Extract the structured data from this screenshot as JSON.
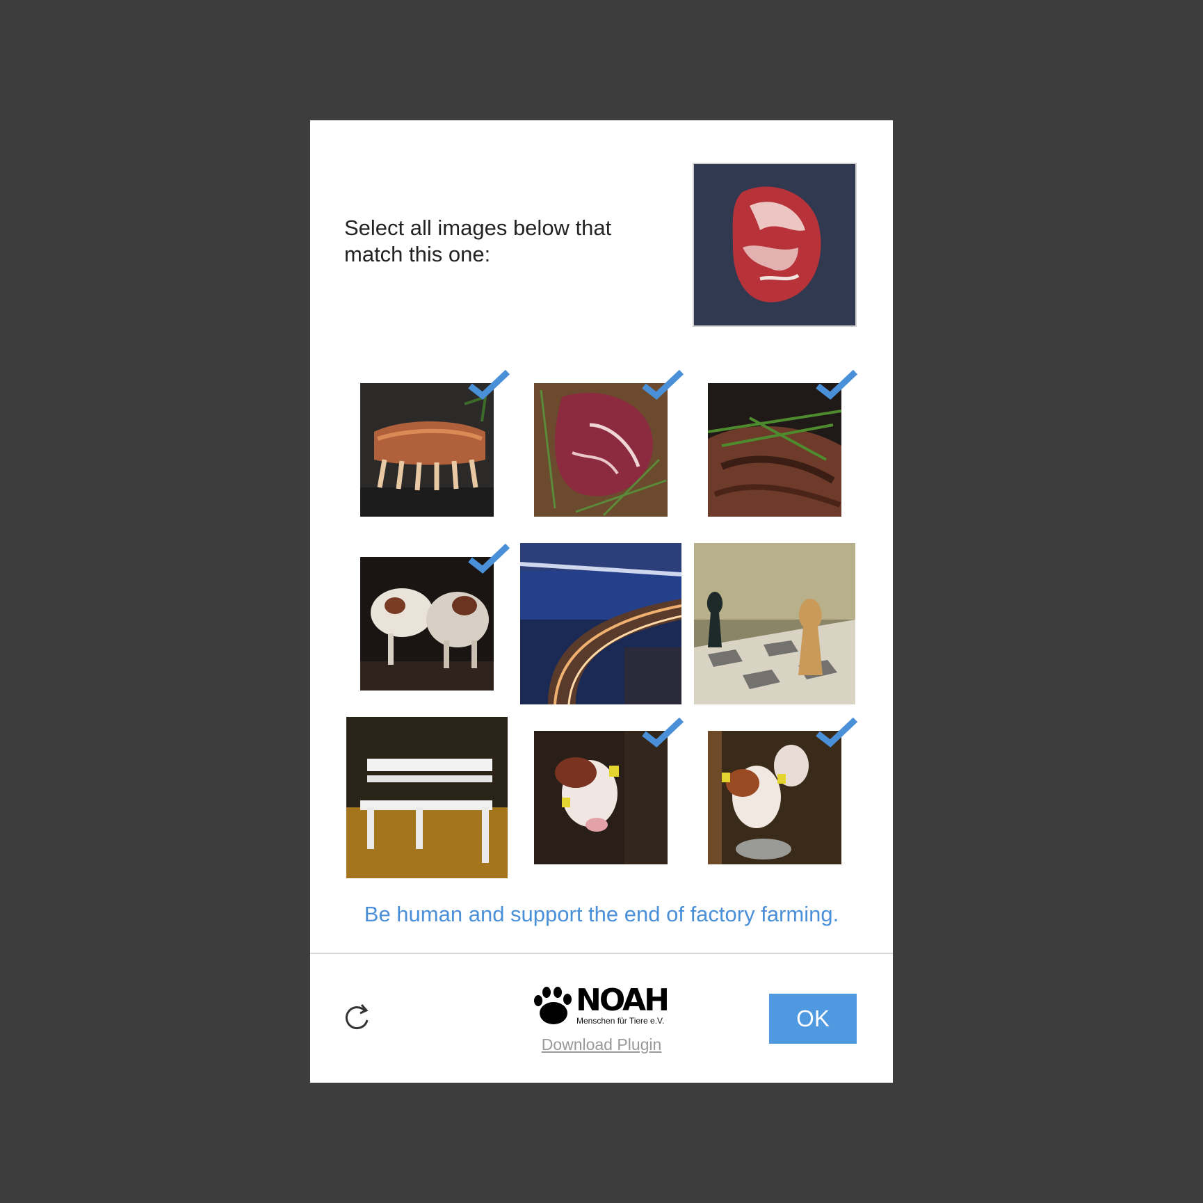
{
  "captcha": {
    "prompt": "Select all images below that match this one:",
    "reference_image": "raw-steak",
    "tiles": [
      {
        "subject": "grilled-rack-of-ribs",
        "selected": true
      },
      {
        "subject": "raw-steak-with-rosemary",
        "selected": true
      },
      {
        "subject": "grilled-steak-with-rosemary",
        "selected": true
      },
      {
        "subject": "cows-in-barn",
        "selected": true
      },
      {
        "subject": "night-highway-bridge",
        "selected": false
      },
      {
        "subject": "chess-pieces",
        "selected": false
      },
      {
        "subject": "white-bench-autumn-leaves",
        "selected": false
      },
      {
        "subject": "calf-with-ear-tags",
        "selected": true
      },
      {
        "subject": "calves-in-stall",
        "selected": true
      }
    ],
    "tagline": "Be human and support the end of factory farming.",
    "footer": {
      "refresh_icon": "refresh-icon",
      "logo_name": "NOAH",
      "logo_subtitle": "Menschen für Tiere e.V.",
      "download_label": "Download Plugin",
      "ok_label": "OK"
    },
    "colors": {
      "accent": "#4f99e1",
      "tagline": "#4a90d9",
      "check": "#4a90d9",
      "backdrop": "#3d3d3d"
    }
  }
}
